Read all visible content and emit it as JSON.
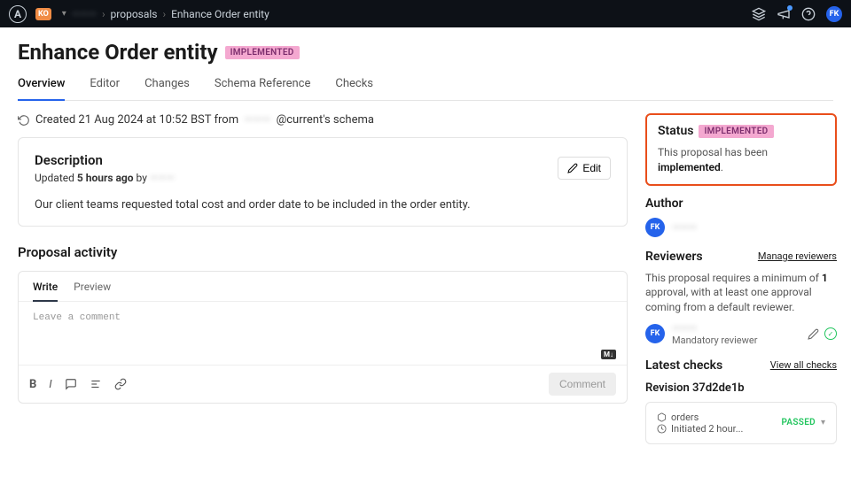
{
  "topbar": {
    "org_badge": "KO",
    "crumb_org": "———",
    "crumb_proposals": "proposals",
    "crumb_current": "Enhance Order entity",
    "avatar_initials": "FK"
  },
  "header": {
    "title": "Enhance Order entity",
    "badge": "IMPLEMENTED",
    "tabs": [
      "Overview",
      "Editor",
      "Changes",
      "Schema Reference",
      "Checks"
    ]
  },
  "created": {
    "prefix": "Created 21 Aug 2024 at 10:52 BST from",
    "blur": "———",
    "suffix": "@current's schema"
  },
  "description": {
    "title": "Description",
    "updated_prefix": "Updated",
    "updated_time": "5 hours ago",
    "updated_by": "by",
    "updated_user": "———",
    "edit": "Edit",
    "body": "Our client teams requested total cost and order date to be included in the order entity."
  },
  "activity": {
    "title": "Proposal activity",
    "write_tab": "Write",
    "preview_tab": "Preview",
    "placeholder": "Leave a comment",
    "md_badge": "M↓",
    "comment_btn": "Comment"
  },
  "status": {
    "title": "Status",
    "badge": "IMPLEMENTED",
    "text_a": "This proposal has been ",
    "text_b": "implemented",
    "text_c": "."
  },
  "author": {
    "title": "Author",
    "initials": "FK",
    "name": "———"
  },
  "reviewers": {
    "title": "Reviewers",
    "manage": "Manage reviewers",
    "text_a": "This proposal requires a minimum of ",
    "min": "1",
    "text_b": " approval, with at least one approval coming from a default reviewer.",
    "initials": "FK",
    "name": "———",
    "role": "Mandatory reviewer"
  },
  "checks": {
    "title": "Latest checks",
    "view_all": "View all checks",
    "revision_label": "Revision 37d2de1b",
    "service": "orders",
    "initiated": "Initiated 2 hour...",
    "result": "PASSED"
  }
}
